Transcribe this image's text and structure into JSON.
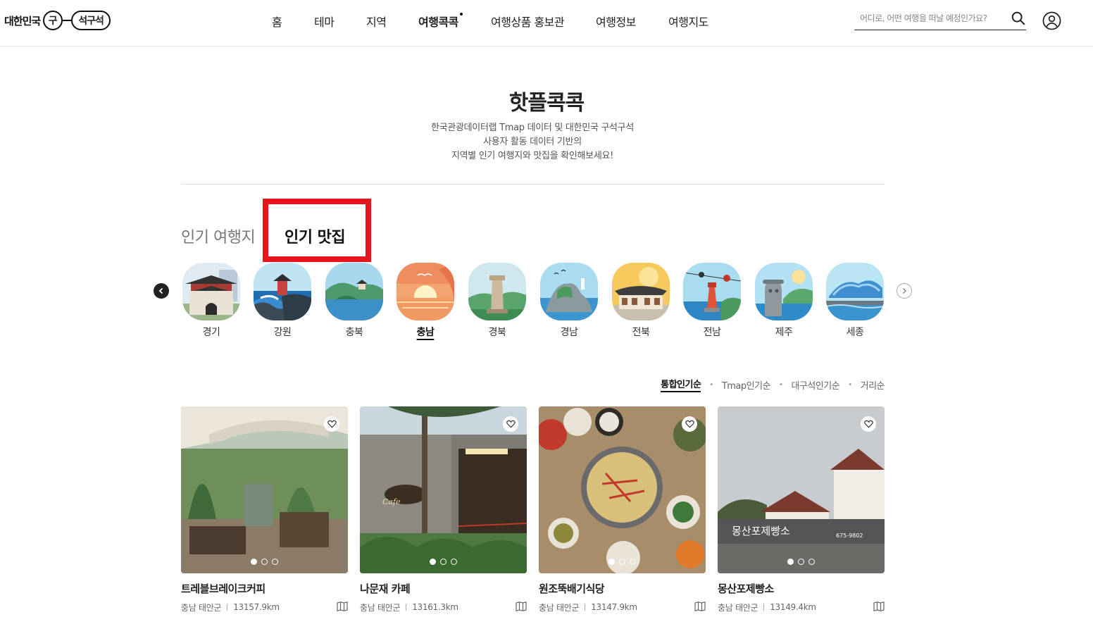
{
  "header": {
    "logo": {
      "prefix": "대한민국",
      "circle": "구",
      "pill": "석구석"
    },
    "nav": [
      {
        "label": "홈"
      },
      {
        "label": "테마"
      },
      {
        "label": "지역"
      },
      {
        "label": "여행콕콕"
      },
      {
        "label": "여행상품 홍보관"
      },
      {
        "label": "여행정보"
      },
      {
        "label": "여행지도"
      }
    ],
    "search_placeholder": "어디로, 어떤 여행을 떠날 예정인가요?"
  },
  "intro": {
    "title": "핫플콕콕",
    "lines": [
      "한국관광데이터랩 Tmap 데이터 및 대한민국 구석구석",
      "사용자 활동 데이터 기반의",
      "지역별 인기 여행지와 맛집을 확인해보세요!"
    ]
  },
  "tabs": [
    {
      "label": "인기 여행지"
    },
    {
      "label": "인기 맛집"
    }
  ],
  "regions": [
    {
      "label": "경기"
    },
    {
      "label": "강원"
    },
    {
      "label": "충북"
    },
    {
      "label": "충남"
    },
    {
      "label": "경북"
    },
    {
      "label": "경남"
    },
    {
      "label": "전북"
    },
    {
      "label": "전남"
    },
    {
      "label": "제주"
    },
    {
      "label": "세종"
    }
  ],
  "sort_options": [
    {
      "label": "통합인기순"
    },
    {
      "label": "Tmap인기순"
    },
    {
      "label": "대구석인기순"
    },
    {
      "label": "거리순"
    }
  ],
  "cards": [
    {
      "name": "트레블브레이크커피",
      "region": "충남 태안군",
      "distance": "13157.9km"
    },
    {
      "name": "나문재 카페",
      "region": "충남 태안군",
      "distance": "13161.3km"
    },
    {
      "name": "원조뚝배기식당",
      "region": "충남 태안군",
      "distance": "13147.9km"
    },
    {
      "name": "몽산포제빵소",
      "region": "충남 태안군",
      "distance": "13149.4km"
    }
  ],
  "images": {
    "card_1_sign": "Cafe",
    "card_3_sign": "몽산포제빵소",
    "card_3_phone": "675-9802"
  }
}
